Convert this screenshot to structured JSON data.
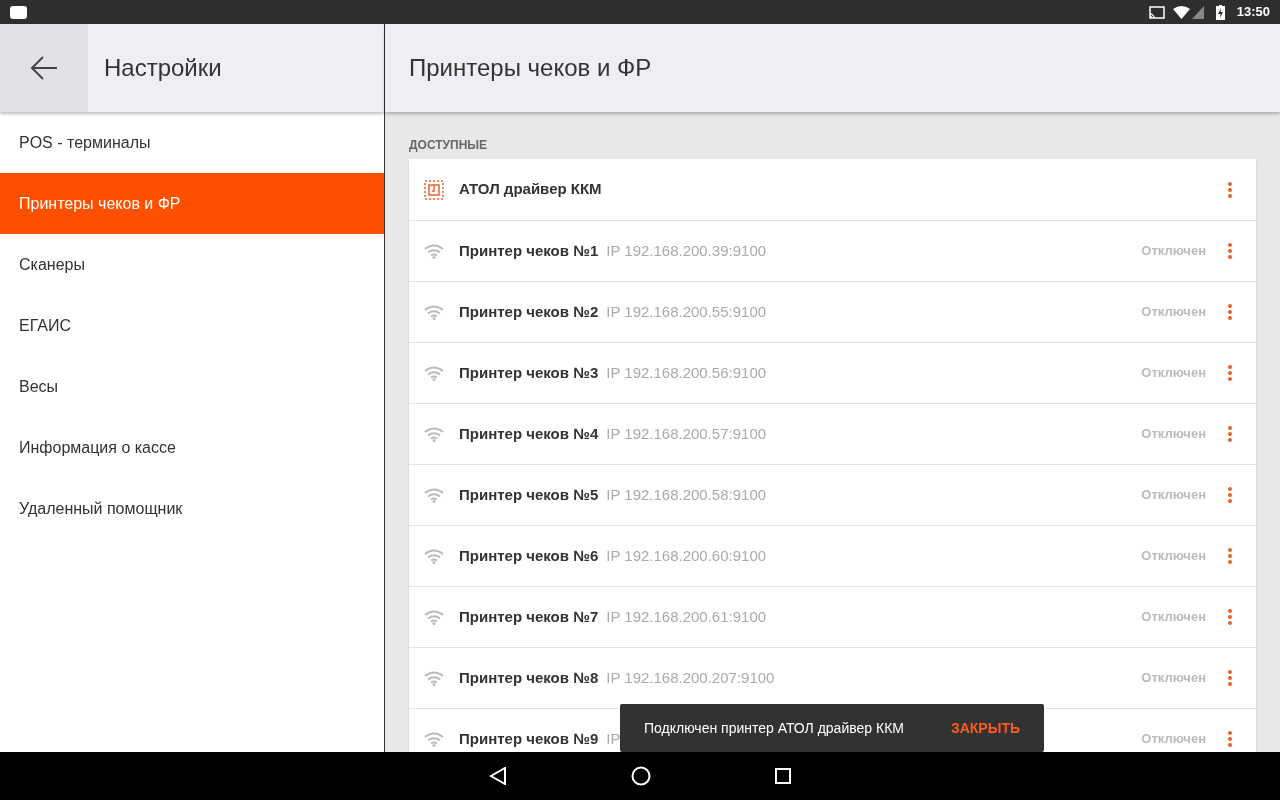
{
  "status_bar": {
    "time": "13:50"
  },
  "sidebar": {
    "title": "Настройки",
    "items": [
      {
        "label": "POS - терминалы",
        "selected": false
      },
      {
        "label": "Принтеры чеков и ФР",
        "selected": true
      },
      {
        "label": "Сканеры",
        "selected": false
      },
      {
        "label": "ЕГАИС",
        "selected": false
      },
      {
        "label": "Весы",
        "selected": false
      },
      {
        "label": "Информация о кассе",
        "selected": false
      },
      {
        "label": "Удаленный помощник",
        "selected": false
      }
    ]
  },
  "content": {
    "title": "Принтеры чеков и ФР",
    "section": "ДОСТУПНЫЕ",
    "devices": [
      {
        "kind": "driver",
        "name": "АТОЛ драйвер ККМ"
      },
      {
        "kind": "network",
        "name": "Принтер чеков №1",
        "address": "IP 192.168.200.39:9100",
        "status": "Отключен"
      },
      {
        "kind": "network",
        "name": "Принтер чеков №2",
        "address": "IP 192.168.200.55:9100",
        "status": "Отключен"
      },
      {
        "kind": "network",
        "name": "Принтер чеков №3",
        "address": "IP 192.168.200.56:9100",
        "status": "Отключен"
      },
      {
        "kind": "network",
        "name": "Принтер чеков №4",
        "address": "IP 192.168.200.57:9100",
        "status": "Отключен"
      },
      {
        "kind": "network",
        "name": "Принтер чеков №5",
        "address": "IP 192.168.200.58:9100",
        "status": "Отключен"
      },
      {
        "kind": "network",
        "name": "Принтер чеков №6",
        "address": "IP 192.168.200.60:9100",
        "status": "Отключен"
      },
      {
        "kind": "network",
        "name": "Принтер чеков №7",
        "address": "IP 192.168.200.61:9100",
        "status": "Отключен"
      },
      {
        "kind": "network",
        "name": "Принтер чеков №8",
        "address": "IP 192.168.200.207:9100",
        "status": "Отключен"
      },
      {
        "kind": "network",
        "name": "Принтер чеков №9",
        "address": "IP",
        "status": "Отключен"
      }
    ]
  },
  "snackbar": {
    "message": "Подключен принтер АТОЛ драйвер ККМ",
    "action": "ЗАКРЫТЬ"
  }
}
